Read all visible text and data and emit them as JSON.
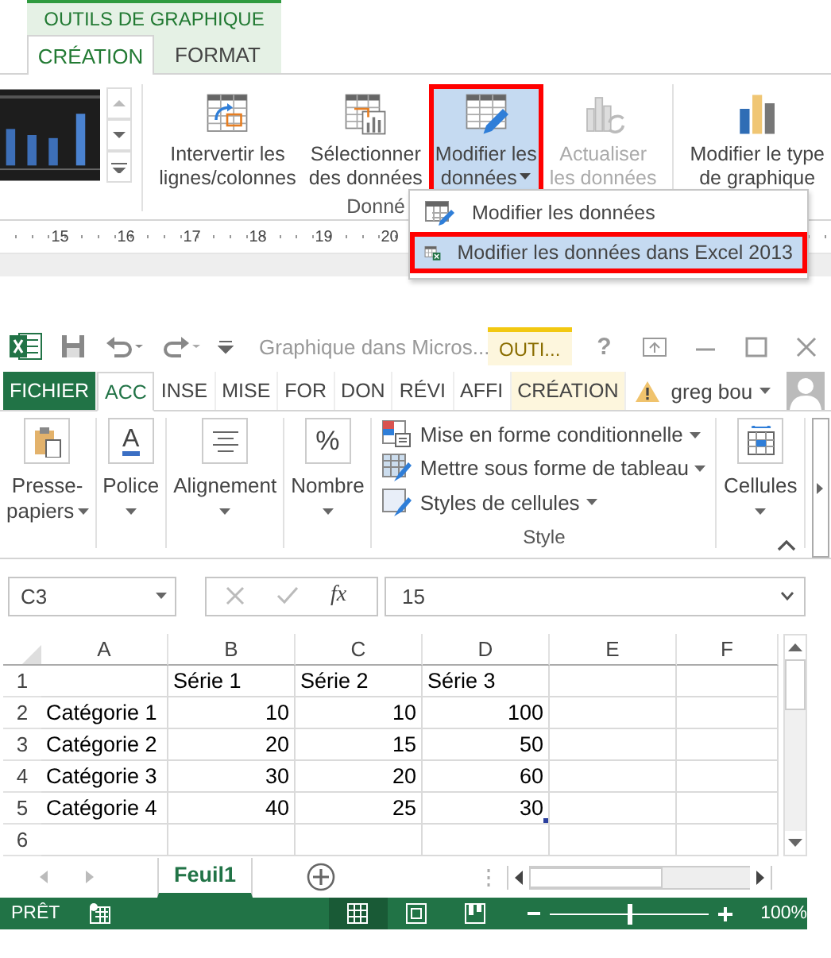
{
  "chart_tools": {
    "context_label": "OUTILS DE GRAPHIQUE",
    "tabs": [
      {
        "label": "CRÉATION",
        "selected": true
      },
      {
        "label": "FORMAT",
        "selected": false
      }
    ],
    "buttons": [
      {
        "kind": "switch",
        "lines": [
          "Intervertir les",
          "lignes/colonnes"
        ],
        "disabled": false,
        "highlighted": false,
        "outlined": false,
        "dropdown": false
      },
      {
        "kind": "select",
        "lines": [
          "Sélectionner",
          "des données"
        ],
        "disabled": false,
        "highlighted": false,
        "outlined": false,
        "dropdown": false
      },
      {
        "kind": "edit",
        "lines": [
          "Modifier les",
          "données"
        ],
        "disabled": false,
        "highlighted": true,
        "outlined": true,
        "dropdown": true
      },
      {
        "kind": "refresh",
        "lines": [
          "Actualiser",
          "les données"
        ],
        "disabled": true,
        "highlighted": false,
        "outlined": false,
        "dropdown": false
      },
      {
        "kind": "chart_type",
        "lines": [
          "Modifier le type",
          "de graphique"
        ],
        "disabled": false,
        "highlighted": false,
        "outlined": false,
        "dropdown": false
      }
    ],
    "group_label": "Donné",
    "ruler_ticks": [
      "15",
      "16",
      "17",
      "18",
      "19",
      "20"
    ],
    "menu": [
      {
        "kind": "edit",
        "label": "Modifier les données",
        "selected": false,
        "outlined": false
      },
      {
        "kind": "excel",
        "label": "Modifier les données dans Excel 2013",
        "selected": true,
        "outlined": true
      }
    ]
  },
  "excel": {
    "title": "Graphique dans Micros...",
    "context_tab": "OUTI...",
    "help": "?",
    "tabs": [
      {
        "label": "FICHIER",
        "kind": "file",
        "selected": false
      },
      {
        "label": "ACC",
        "kind": "normal",
        "selected": true
      },
      {
        "label": "INSE",
        "kind": "normal",
        "selected": false
      },
      {
        "label": "MISE",
        "kind": "normal",
        "selected": false
      },
      {
        "label": "FOR",
        "kind": "normal",
        "selected": false
      },
      {
        "label": "DON",
        "kind": "normal",
        "selected": false
      },
      {
        "label": "RÉVI",
        "kind": "normal",
        "selected": false
      },
      {
        "label": "AFFI",
        "kind": "normal",
        "selected": false
      },
      {
        "label": "CRÉATION",
        "kind": "contextual",
        "selected": false
      }
    ],
    "user": "greg bou",
    "ribbon": [
      {
        "kind": "clipboard",
        "lines": [
          "Presse-",
          "papiers"
        ]
      },
      {
        "kind": "font",
        "icon_text": "A",
        "lines": [
          "Police"
        ]
      },
      {
        "kind": "alignment",
        "lines": [
          "Alignement"
        ]
      },
      {
        "kind": "number",
        "icon_text": "%",
        "lines": [
          "Nombre"
        ]
      },
      {
        "kind": "styles",
        "items": [
          {
            "kind": "conditional",
            "label": "Mise en forme conditionnelle"
          },
          {
            "kind": "table",
            "label": "Mettre sous forme de tableau"
          },
          {
            "kind": "cell",
            "label": "Styles de cellules"
          }
        ],
        "group_label": "Style"
      },
      {
        "kind": "cells",
        "lines": [
          "Cellules"
        ]
      }
    ],
    "name_box": "C3",
    "function_label": "fx",
    "formula": "15",
    "columns": [
      "A",
      "B",
      "C",
      "D",
      "E",
      "F"
    ],
    "rows": [
      {
        "number": "1",
        "kind": "series",
        "cells": [
          "Série 1",
          "Série 2",
          "Série 3"
        ]
      },
      {
        "number": "2",
        "kind": "data",
        "label": "Catégorie 1",
        "cells": [
          "10",
          "10",
          "100"
        ]
      },
      {
        "number": "3",
        "kind": "data",
        "label": "Catégorie 2",
        "cells": [
          "20",
          "15",
          "50"
        ]
      },
      {
        "number": "4",
        "kind": "data",
        "label": "Catégorie 3",
        "cells": [
          "30",
          "20",
          "60"
        ]
      },
      {
        "number": "5",
        "kind": "data",
        "label": "Catégorie 4",
        "cells": [
          "40",
          "25",
          "30"
        ]
      },
      {
        "number": "6",
        "kind": "blank"
      }
    ],
    "sheets": [
      {
        "label": "Feuil1",
        "selected": true
      }
    ],
    "status": "PRÊT",
    "views": [
      {
        "kind": "normal",
        "selected": true
      },
      {
        "kind": "layout",
        "selected": false
      },
      {
        "kind": "pagebreak",
        "selected": false
      }
    ],
    "zoom": {
      "level": 0.5,
      "label": "100%"
    }
  }
}
